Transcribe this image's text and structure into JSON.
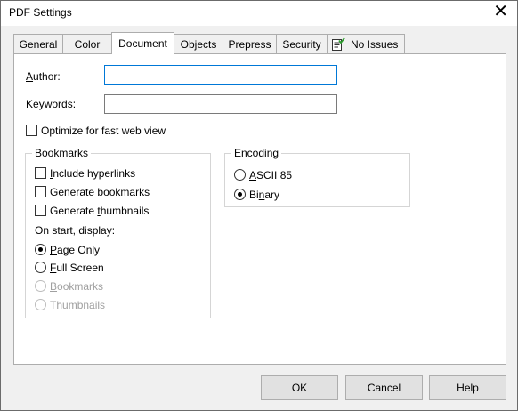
{
  "window": {
    "title": "PDF Settings",
    "close_icon": "close-x"
  },
  "tabs": [
    {
      "label": "General"
    },
    {
      "label": "Color"
    },
    {
      "label": "Document",
      "active": true
    },
    {
      "label": "Objects"
    },
    {
      "label": "Prepress"
    },
    {
      "label": "Security"
    },
    {
      "label": "No Issues",
      "icon": "document-check-icon"
    }
  ],
  "document": {
    "author": {
      "label_first": "A",
      "label_rest": "uthor:",
      "value": ""
    },
    "keywords": {
      "label_first": "K",
      "label_rest": "eywords:",
      "value": ""
    },
    "optimize": {
      "label": "Optimize for fast web view",
      "checked": false
    }
  },
  "bookmarks": {
    "title": "Bookmarks",
    "include_hyperlinks": {
      "underline": "I",
      "rest": "nclude hyperlinks",
      "checked": false
    },
    "generate_bookmarks": {
      "prefix": "Generate ",
      "underline": "b",
      "rest": "ookmarks",
      "checked": false
    },
    "generate_thumbnails": {
      "prefix": "Generate ",
      "underline": "t",
      "rest": "humbnails",
      "checked": false
    },
    "on_start_label": "On start, display:",
    "page_only": {
      "underline": "P",
      "rest": "age Only",
      "selected": true
    },
    "full_screen": {
      "underline": "F",
      "rest": "ull Screen",
      "selected": false
    },
    "bookmarks_opt": {
      "underline": "B",
      "rest": "ookmarks",
      "selected": false,
      "enabled": false
    },
    "thumbnails_opt": {
      "underline": "T",
      "rest": "humbnails",
      "selected": false,
      "enabled": false
    }
  },
  "encoding": {
    "title": "Encoding",
    "ascii": {
      "underline": "A",
      "rest": "SCII 85",
      "selected": false
    },
    "binary": {
      "prefix": "Bi",
      "underline": "n",
      "rest": "ary",
      "selected": true
    }
  },
  "buttons": {
    "ok": "OK",
    "cancel": "Cancel",
    "help": "Help"
  },
  "colors": {
    "focus_border": "#0078d7",
    "panel_bg": "#ffffff",
    "dialog_bg": "#f0f0f0"
  }
}
